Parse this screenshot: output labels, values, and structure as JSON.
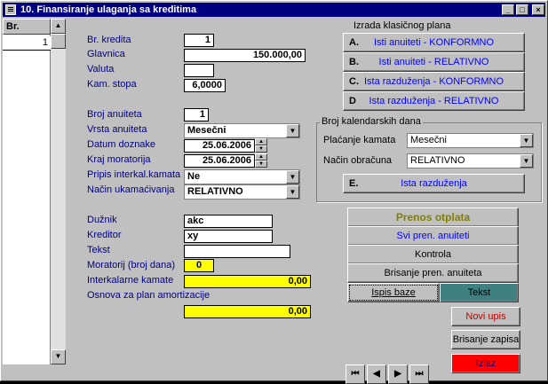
{
  "window": {
    "title": "10. Finansiranje ulaganja sa kreditima"
  },
  "record_selector": {
    "header": "Br.",
    "row_value": "1"
  },
  "form": {
    "br_kredita": {
      "label": "Br. kredita",
      "value": "1"
    },
    "glavnica": {
      "label": "Glavnica",
      "value": "150.000,00"
    },
    "valuta": {
      "label": "Valuta",
      "value": ""
    },
    "kam_stopa": {
      "label": "Kam. stopa",
      "value": "6,0000"
    },
    "broj_anuiteta": {
      "label": "Broj anuiteta",
      "value": "1"
    },
    "vrsta_anuiteta": {
      "label": "Vrsta anuiteta",
      "value": "Mesečni"
    },
    "datum_doznake": {
      "label": "Datum doznake",
      "value": "25.06.2006"
    },
    "kraj_moratorija": {
      "label": "Kraj moratorija",
      "value": "25.06.2006"
    },
    "pripis": {
      "label": "Pripis interkal.kamata",
      "value": "Ne"
    },
    "nacin_ukamacivanja": {
      "label": "Način ukamaćivanja",
      "value": "RELATIVNO"
    },
    "duznik": {
      "label": "Dužnik",
      "value": "akc"
    },
    "kreditor": {
      "label": "Kreditor",
      "value": "xy"
    },
    "tekst": {
      "label": "Tekst",
      "value": ""
    },
    "moratorij": {
      "label": "Moratorij (broj dana)",
      "value": "0"
    },
    "interkalarne": {
      "label": "Interkalarne kamate",
      "value": "0,00"
    },
    "osnova": {
      "label": "Osnova za plan amortizacije",
      "value": "0,00"
    }
  },
  "plan": {
    "title": "Izrada klasičnog plana",
    "buttons": [
      {
        "key": "A.",
        "label": "Isti anuiteti - KONFORMNO"
      },
      {
        "key": "B.",
        "label": "Isti anuiteti - RELATIVNO"
      },
      {
        "key": "C.",
        "label": "Ista razduženja - KONFORMNO"
      },
      {
        "key": "D",
        "label": "Ista razduženja - RELATIVNO"
      }
    ]
  },
  "kalendar": {
    "title": "Broj kalendarskih dana",
    "placanje_label": "Plaćanje kamata",
    "placanje_value": "Mesečni",
    "nacin_label": "Način obračuna",
    "nacin_value": "RELATIVNO",
    "e_key": "E.",
    "e_label": "Ista razduženja"
  },
  "actions": {
    "prenos": "Prenos otplata",
    "svi_pren": "Svi pren. anuiteti",
    "kontrola": "Kontrola",
    "brisanje_pren": "Brisanje pren. anuiteta",
    "ispis": "Ispis baze",
    "tekst": "Tekst",
    "novi_upis": "Novi upis",
    "brisanje_zapisa": "Brisanje zapisa",
    "izlaz": "Izlaz"
  },
  "colors": {
    "titlebar": "#000080",
    "highlight": "#ffff00",
    "izlaz": "#ff0000",
    "tekst_btn": "#408080",
    "prenos": "#808000"
  }
}
